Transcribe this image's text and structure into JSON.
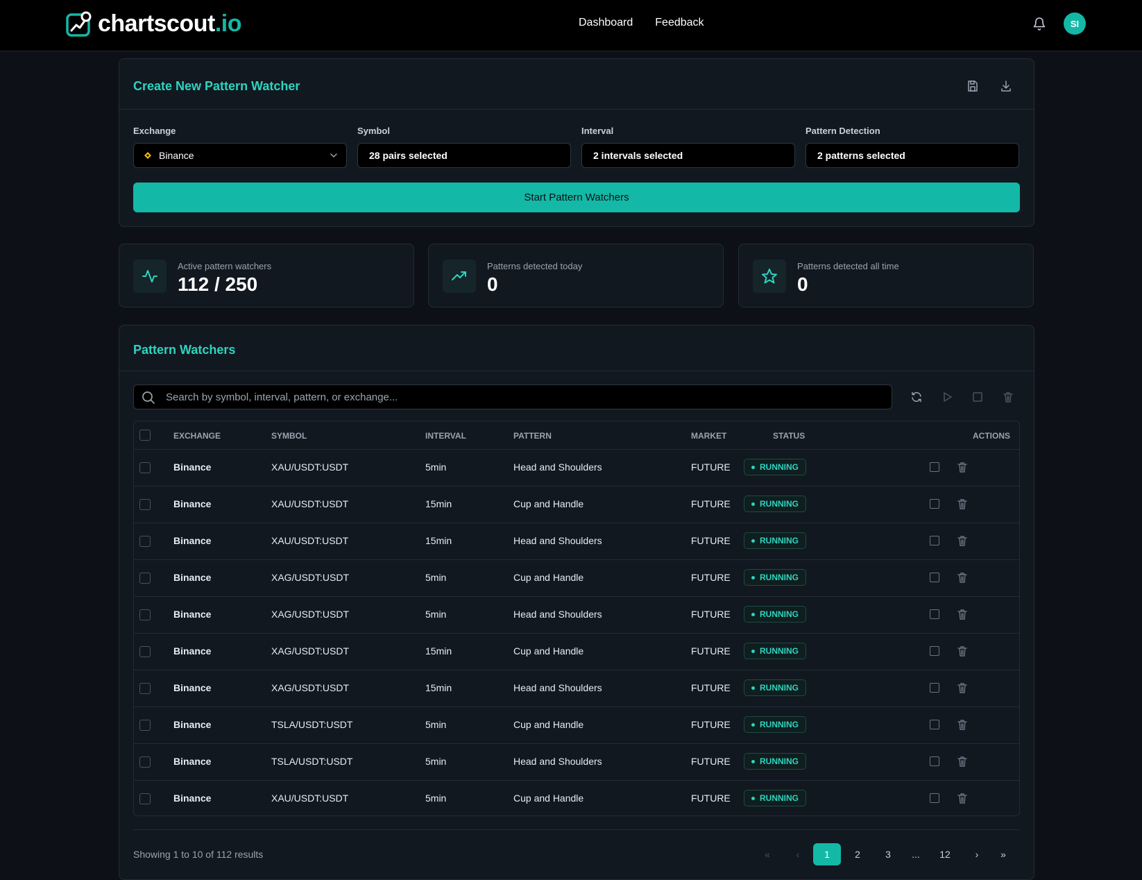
{
  "header": {
    "logo_main": "chartscout",
    "logo_tld": ".io",
    "nav": [
      "Dashboard",
      "Feedback"
    ],
    "avatar_initials": "SI"
  },
  "create": {
    "title": "Create New Pattern Watcher",
    "fields": [
      {
        "label": "Exchange",
        "value": "Binance"
      },
      {
        "label": "Symbol",
        "value": "28 pairs selected"
      },
      {
        "label": "Interval",
        "value": "2 intervals selected"
      },
      {
        "label": "Pattern Detection",
        "value": "2 patterns selected"
      }
    ],
    "start_label": "Start Pattern Watchers"
  },
  "stats": [
    {
      "label": "Active pattern watchers",
      "value": "112 / 250",
      "icon": "activity-icon"
    },
    {
      "label": "Patterns detected today",
      "value": "0",
      "icon": "trending-up-icon"
    },
    {
      "label": "Patterns detected all time",
      "value": "0",
      "icon": "star-icon"
    }
  ],
  "watchers": {
    "title": "Pattern Watchers",
    "search_placeholder": "Search by symbol, interval, pattern, or exchange...",
    "columns": [
      "EXCHANGE",
      "SYMBOL",
      "INTERVAL",
      "PATTERN",
      "MARKET",
      "STATUS",
      "ACTIONS"
    ],
    "rows": [
      {
        "exchange": "Binance",
        "symbol": "XAU/USDT:USDT",
        "interval": "5min",
        "pattern": "Head and Shoulders",
        "market": "FUTURE",
        "status": "RUNNING"
      },
      {
        "exchange": "Binance",
        "symbol": "XAU/USDT:USDT",
        "interval": "15min",
        "pattern": "Cup and Handle",
        "market": "FUTURE",
        "status": "RUNNING"
      },
      {
        "exchange": "Binance",
        "symbol": "XAU/USDT:USDT",
        "interval": "15min",
        "pattern": "Head and Shoulders",
        "market": "FUTURE",
        "status": "RUNNING"
      },
      {
        "exchange": "Binance",
        "symbol": "XAG/USDT:USDT",
        "interval": "5min",
        "pattern": "Cup and Handle",
        "market": "FUTURE",
        "status": "RUNNING"
      },
      {
        "exchange": "Binance",
        "symbol": "XAG/USDT:USDT",
        "interval": "5min",
        "pattern": "Head and Shoulders",
        "market": "FUTURE",
        "status": "RUNNING"
      },
      {
        "exchange": "Binance",
        "symbol": "XAG/USDT:USDT",
        "interval": "15min",
        "pattern": "Cup and Handle",
        "market": "FUTURE",
        "status": "RUNNING"
      },
      {
        "exchange": "Binance",
        "symbol": "XAG/USDT:USDT",
        "interval": "15min",
        "pattern": "Head and Shoulders",
        "market": "FUTURE",
        "status": "RUNNING"
      },
      {
        "exchange": "Binance",
        "symbol": "TSLA/USDT:USDT",
        "interval": "5min",
        "pattern": "Cup and Handle",
        "market": "FUTURE",
        "status": "RUNNING"
      },
      {
        "exchange": "Binance",
        "symbol": "TSLA/USDT:USDT",
        "interval": "5min",
        "pattern": "Head and Shoulders",
        "market": "FUTURE",
        "status": "RUNNING"
      },
      {
        "exchange": "Binance",
        "symbol": "XAU/USDT:USDT",
        "interval": "5min",
        "pattern": "Cup and Handle",
        "market": "FUTURE",
        "status": "RUNNING"
      }
    ],
    "showing": "Showing 1 to 10 of 112 results",
    "pages": [
      "1",
      "2",
      "3",
      "...",
      "12"
    ],
    "current_page": "1"
  },
  "colors": {
    "accent": "#14b8a6",
    "background": "#0d1117",
    "card": "#111820"
  }
}
